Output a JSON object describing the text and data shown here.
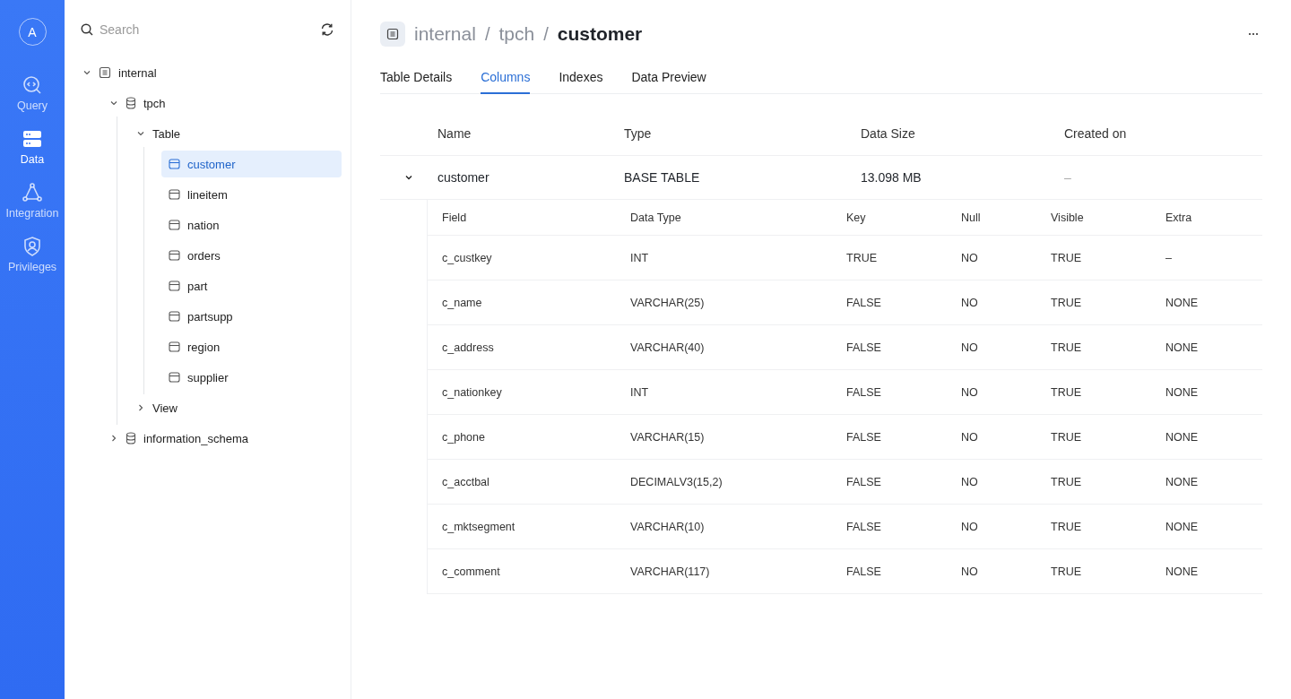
{
  "nav": {
    "avatar": "A",
    "items": [
      {
        "label": "Query",
        "kind": "query",
        "selected": false
      },
      {
        "label": "Data",
        "kind": "data",
        "selected": true
      },
      {
        "label": "Integration",
        "kind": "integration",
        "selected": false
      },
      {
        "label": "Privileges",
        "kind": "privileges",
        "selected": false
      }
    ]
  },
  "sidebar": {
    "search": {
      "placeholder": "Search"
    },
    "tree": [
      {
        "label": "internal",
        "kind": "catalog",
        "expanded": true,
        "selected": false,
        "children": [
          {
            "label": "tpch",
            "kind": "database",
            "expanded": true,
            "selected": false,
            "children": [
              {
                "label": "Table",
                "kind": "folder",
                "expanded": true,
                "selected": false,
                "children": [
                  {
                    "label": "customer",
                    "kind": "table",
                    "selected": true
                  },
                  {
                    "label": "lineitem",
                    "kind": "table",
                    "selected": false
                  },
                  {
                    "label": "nation",
                    "kind": "table",
                    "selected": false
                  },
                  {
                    "label": "orders",
                    "kind": "table",
                    "selected": false
                  },
                  {
                    "label": "part",
                    "kind": "table",
                    "selected": false
                  },
                  {
                    "label": "partsupp",
                    "kind": "table",
                    "selected": false
                  },
                  {
                    "label": "region",
                    "kind": "table",
                    "selected": false
                  },
                  {
                    "label": "supplier",
                    "kind": "table",
                    "selected": false
                  }
                ]
              },
              {
                "label": "View",
                "kind": "folder",
                "expanded": false,
                "selected": false
              }
            ]
          },
          {
            "label": "information_schema",
            "kind": "database",
            "expanded": false,
            "selected": false
          }
        ]
      }
    ]
  },
  "breadcrumb": [
    {
      "kind": "link",
      "text": "internal"
    },
    {
      "kind": "separator",
      "text": "/"
    },
    {
      "kind": "link",
      "text": "tpch"
    },
    {
      "kind": "separator",
      "text": "/"
    },
    {
      "kind": "current",
      "text": "customer"
    }
  ],
  "tabs": [
    {
      "label": "Table Details",
      "selected": false
    },
    {
      "label": "Columns",
      "selected": true
    },
    {
      "label": "Indexes",
      "selected": false
    },
    {
      "label": "Data Preview",
      "selected": false
    }
  ],
  "table": {
    "columns": [
      "Name",
      "Type",
      "Data Size",
      "Created on"
    ],
    "rows": [
      {
        "cells": [
          "customer",
          "BASE TABLE",
          "13.098 MB",
          "–"
        ],
        "expanded": true
      }
    ]
  },
  "detail": {
    "columns": [
      "Field",
      "Data Type",
      "Key",
      "Null",
      "Visible",
      "Extra"
    ],
    "rows": [
      [
        "c_custkey",
        "INT",
        "TRUE",
        "NO",
        "TRUE",
        "–"
      ],
      [
        "c_name",
        "VARCHAR(25)",
        "FALSE",
        "NO",
        "TRUE",
        "NONE"
      ],
      [
        "c_address",
        "VARCHAR(40)",
        "FALSE",
        "NO",
        "TRUE",
        "NONE"
      ],
      [
        "c_nationkey",
        "INT",
        "FALSE",
        "NO",
        "TRUE",
        "NONE"
      ],
      [
        "c_phone",
        "VARCHAR(15)",
        "FALSE",
        "NO",
        "TRUE",
        "NONE"
      ],
      [
        "c_acctbal",
        "DECIMALV3(15,2)",
        "FALSE",
        "NO",
        "TRUE",
        "NONE"
      ],
      [
        "c_mktsegment",
        "VARCHAR(10)",
        "FALSE",
        "NO",
        "TRUE",
        "NONE"
      ],
      [
        "c_comment",
        "VARCHAR(117)",
        "FALSE",
        "NO",
        "TRUE",
        "NONE"
      ]
    ]
  }
}
